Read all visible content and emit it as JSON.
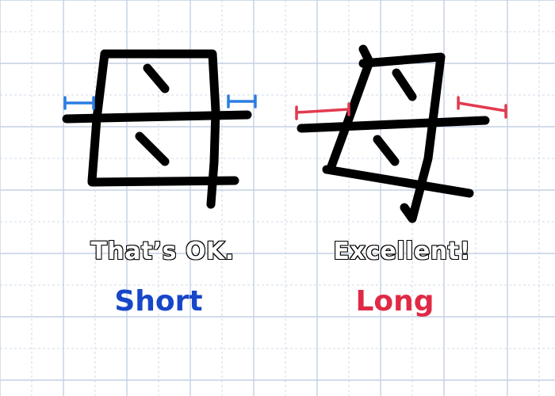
{
  "panels": [
    {
      "verdict": "That’s OK.",
      "label": "Short",
      "label_color": "#1846c8",
      "marker_color": "#2a7de1"
    },
    {
      "verdict": "Excellent!",
      "label": "Long",
      "label_color": "#e02a45",
      "marker_color": "#e23a4f"
    }
  ],
  "grid": {
    "line_color": "#c3d0e4",
    "background": "#ffffff"
  }
}
